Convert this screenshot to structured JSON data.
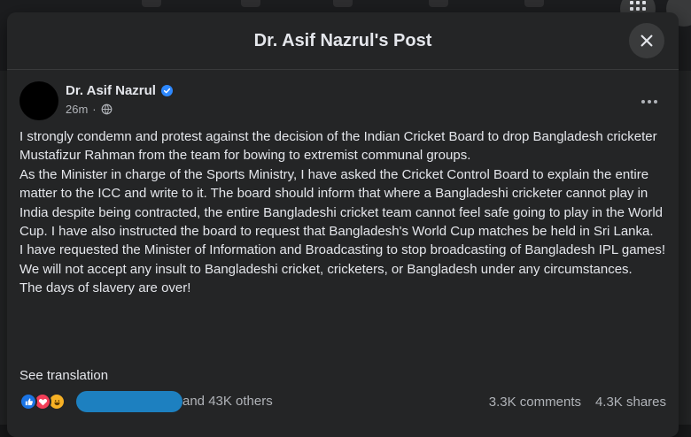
{
  "modal": {
    "title": "Dr. Asif Nazrul's Post"
  },
  "post": {
    "author": "Dr. Asif Nazrul",
    "timestamp": "26m",
    "paragraphs": [
      "I strongly condemn and protest against the decision of the Indian Cricket Board to drop Bangladesh cricketer Mustafizur Rahman from the team for bowing to extremist communal groups.",
      "As the Minister in charge of the Sports Ministry, I have asked the Cricket Control Board to explain the entire matter to the ICC and write to it. The board should inform that where a Bangladeshi cricketer cannot play in India despite being contracted, the entire Bangladeshi cricket team cannot feel safe going to play in the World Cup. I have also instructed the board to request that Bangladesh's World Cup matches be held in Sri Lanka.",
      "I have requested the Minister of Information and Broadcasting to stop broadcasting of Bangladesh IPL games!",
      "We will not accept any insult to Bangladeshi cricket, cricketers, or Bangladesh under any circumstances.",
      "The days of slavery are over!"
    ],
    "see_translation": "See translation"
  },
  "engagement": {
    "reactions_text": "and 43K others",
    "comments": "3.3K comments",
    "shares": "4.3K shares"
  },
  "icons": {
    "reactions": [
      "like-icon",
      "love-icon",
      "haha-icon"
    ],
    "header": [
      "close-icon",
      "more-options-icon",
      "verified-badge-icon",
      "globe-icon",
      "menu-grid-icon"
    ]
  },
  "colors": {
    "modal_bg": "#242526",
    "text_primary": "#e4e6eb",
    "text_secondary": "#b0b3b8",
    "verified_blue": "#2d88ff",
    "like_blue": "#1b74e4",
    "love_red": "#f33e58",
    "haha_yellow": "#f7b125"
  }
}
